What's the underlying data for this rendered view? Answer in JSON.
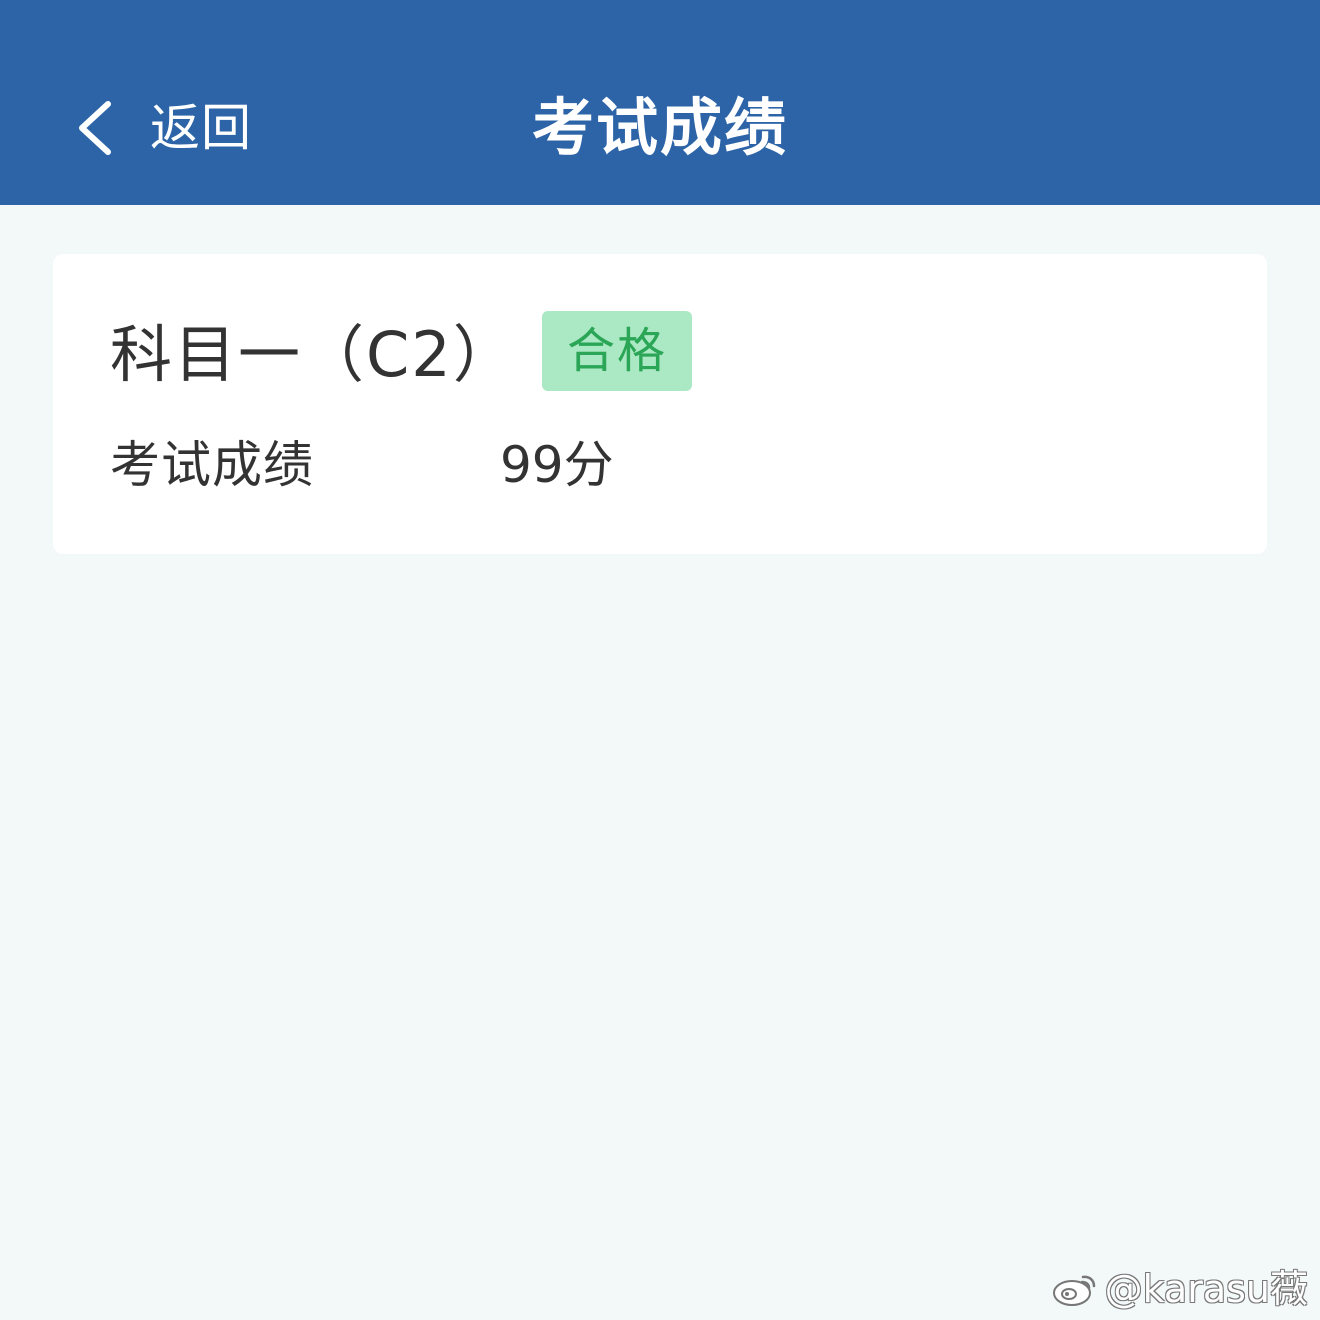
{
  "header": {
    "back_label": "返回",
    "title": "考试成绩",
    "back_icon": "chevron-left-icon"
  },
  "result_card": {
    "subject": "科目一（C2）",
    "status": "合格",
    "score_label": "考试成绩",
    "score_value": "99分"
  },
  "watermark": {
    "icon": "weibo-icon",
    "text": "@karasu薇"
  },
  "colors": {
    "header_background": "#2d64a7",
    "page_background": "#f3f8f8",
    "card_background": "#ffffff",
    "primary_text": "#333333",
    "badge_background": "#abe8c4",
    "badge_text": "#2aa656",
    "header_text": "#ffffff"
  }
}
